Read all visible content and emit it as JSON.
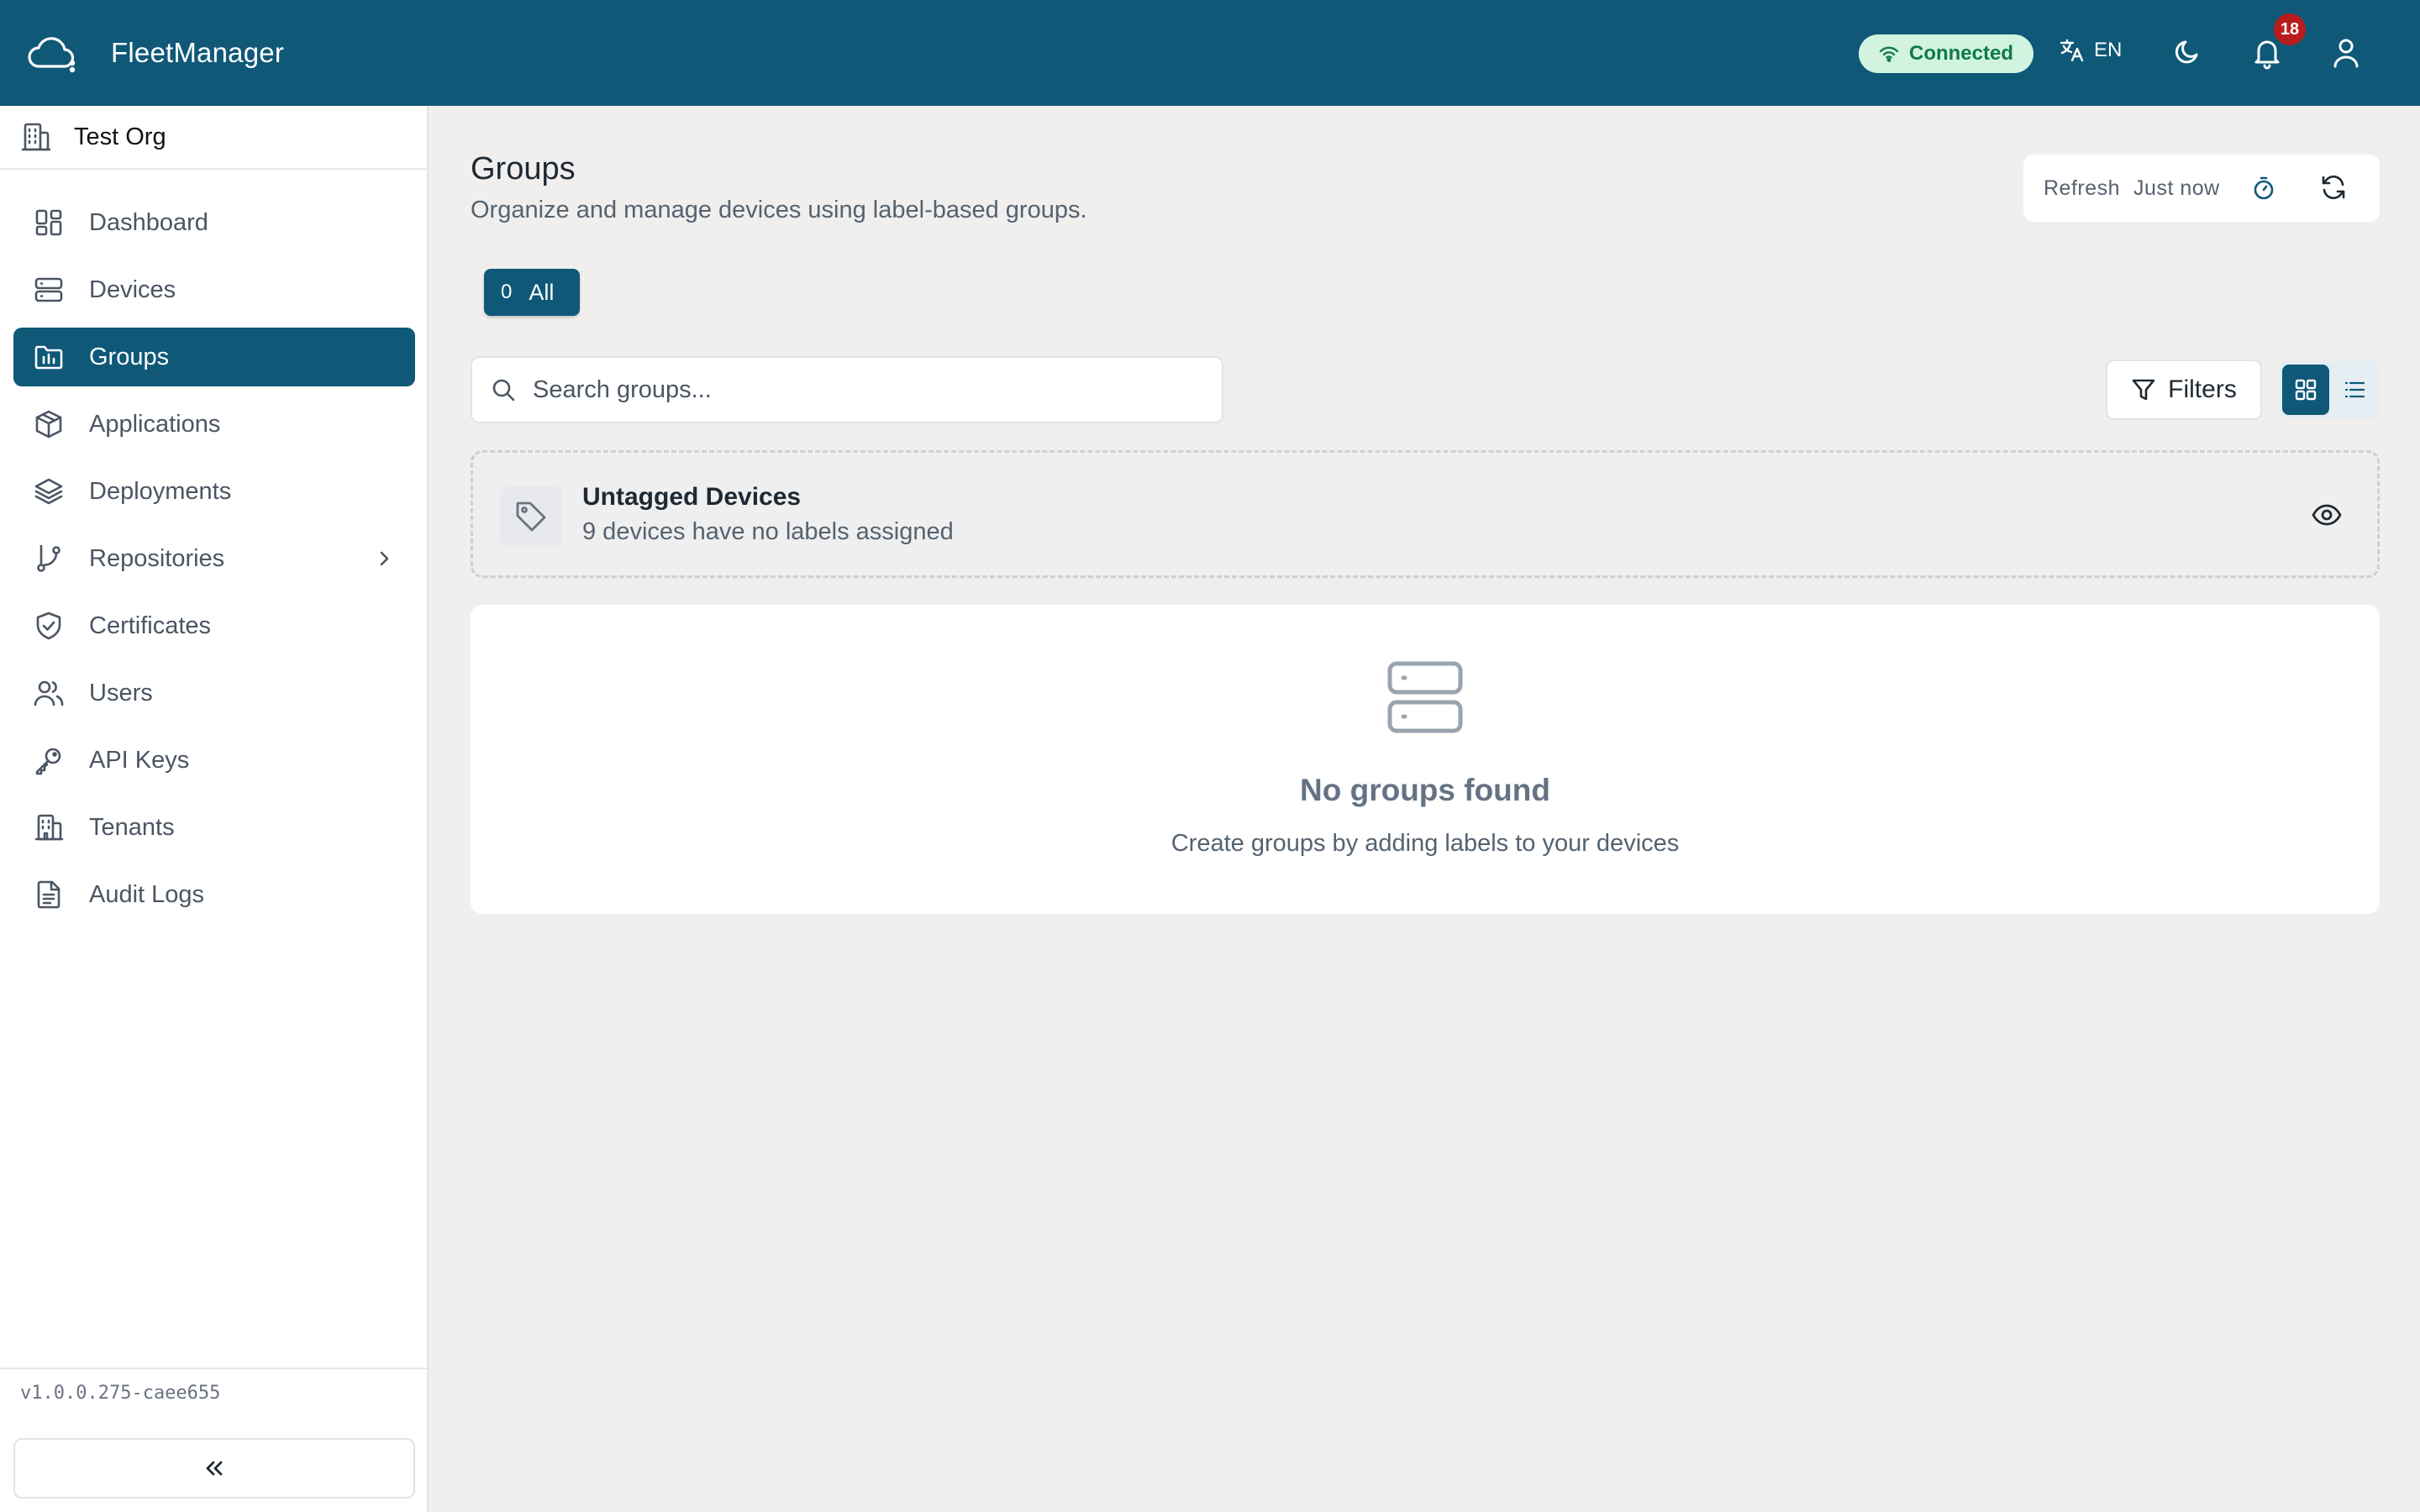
{
  "app": {
    "name": "FleetManager"
  },
  "header": {
    "status": "Connected",
    "language": "EN",
    "notification_count": "18"
  },
  "sidebar": {
    "org_name": "Test Org",
    "items": [
      {
        "label": "Dashboard",
        "icon": "dashboard-icon"
      },
      {
        "label": "Devices",
        "icon": "server-icon"
      },
      {
        "label": "Groups",
        "icon": "folder-chart-icon",
        "active": true
      },
      {
        "label": "Applications",
        "icon": "package-icon"
      },
      {
        "label": "Deployments",
        "icon": "layers-icon"
      },
      {
        "label": "Repositories",
        "icon": "git-branch-icon"
      },
      {
        "label": "Certificates",
        "icon": "shield-check-icon"
      },
      {
        "label": "Users",
        "icon": "users-icon"
      },
      {
        "label": "API Keys",
        "icon": "key-icon"
      },
      {
        "label": "Tenants",
        "icon": "building-icon"
      },
      {
        "label": "Audit Logs",
        "icon": "file-text-icon"
      }
    ],
    "version": "v1.0.0.275-caee655"
  },
  "page": {
    "title": "Groups",
    "subtitle": "Organize and manage devices using label-based groups."
  },
  "refresh": {
    "label": "Refresh",
    "time": "Just now"
  },
  "tabs": [
    {
      "count": "0",
      "label": "All"
    }
  ],
  "search": {
    "placeholder": "Search groups..."
  },
  "toolbar": {
    "filters_label": "Filters"
  },
  "untagged": {
    "title": "Untagged Devices",
    "subtitle": "9 devices have no labels assigned"
  },
  "empty": {
    "title": "No groups found",
    "subtitle": "Create groups by adding labels to your devices"
  },
  "colors": {
    "primary": "#0f5877",
    "connected_bg": "#d1f3e0",
    "connected_text": "#0e7a45",
    "badge_red": "#b91c1c"
  }
}
